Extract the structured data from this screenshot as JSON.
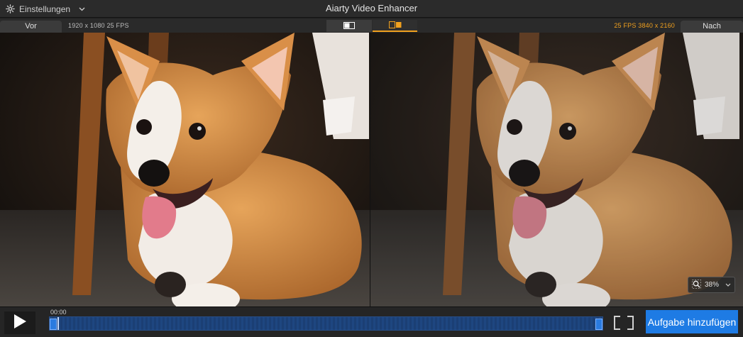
{
  "window": {
    "title": "Aiarty Video Enhancer"
  },
  "header": {
    "settings_label": "Einstellungen",
    "settings_icon": "gear-icon",
    "dropdown_icon": "chevron-down-icon"
  },
  "compare": {
    "before_label": "Vor",
    "after_label": "Nach",
    "source_info": "1920 x 1080  25 FPS",
    "output_info": "25 FPS  3840 x 2160",
    "view_modes": [
      "single-view-icon",
      "split-view-icon"
    ],
    "active_view": "split-view-icon"
  },
  "zoom": {
    "value": "38%",
    "icon": "zoom-icon"
  },
  "playback": {
    "current_time": "00:00",
    "play_icon": "play-icon",
    "progress": 0.0
  },
  "actions": {
    "add_task_label": "Aufgabe hinzufügen"
  },
  "colors": {
    "accent": "#f0a01e",
    "primary_button": "#1e7be4",
    "timeline": "#1c3b6b"
  }
}
